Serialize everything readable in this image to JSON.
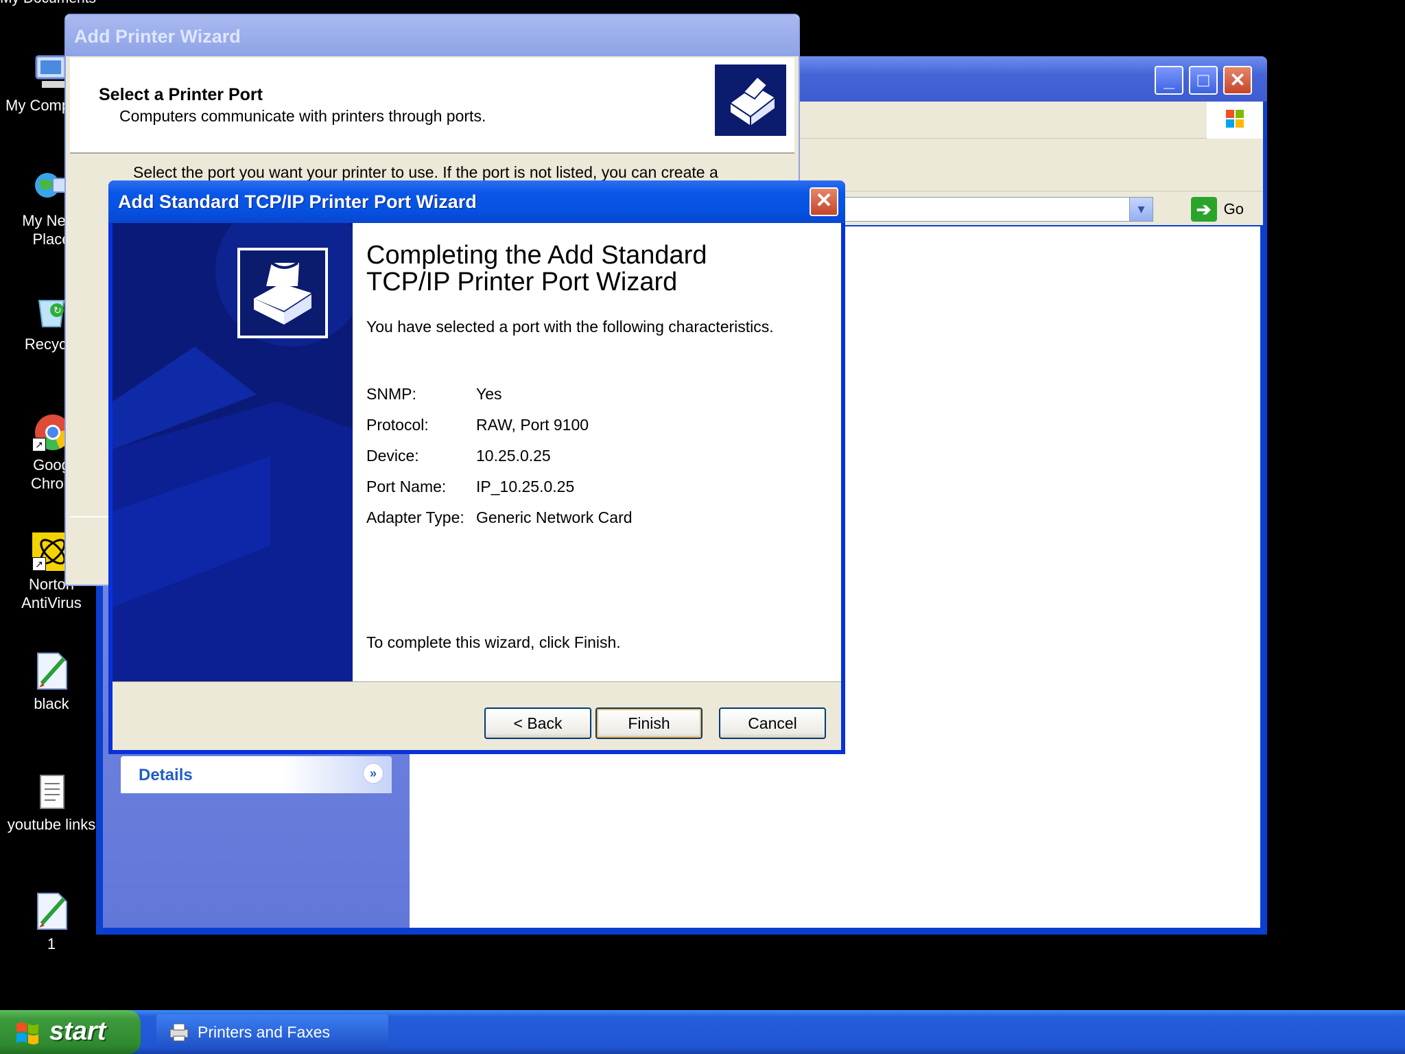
{
  "desktop": {
    "top_text": "My Documents",
    "icons": [
      {
        "label": "My Comp",
        "icon": "my-computer-icon"
      },
      {
        "label": "My Netw\nPlace",
        "icon": "my-network-places-icon"
      },
      {
        "label": "Recycle",
        "icon": "recycle-bin-icon"
      },
      {
        "label": "Goog\nChron",
        "icon": "google-chrome-icon"
      },
      {
        "label": "Norton\nAntiVirus",
        "icon": "norton-antivirus-icon"
      },
      {
        "label": "black",
        "icon": "image-file-icon"
      },
      {
        "label": "youtube links",
        "icon": "text-file-icon"
      },
      {
        "label": "1",
        "icon": "image-file-icon"
      }
    ]
  },
  "printers_window": {
    "address_go_label": "Go",
    "details_label": "Details",
    "controls": [
      "minimize",
      "maximize",
      "close"
    ]
  },
  "add_printer_wizard": {
    "title": "Add Printer Wizard",
    "heading": "Select a Printer Port",
    "subheading": "Computers communicate with printers through ports.",
    "body": "Select the port you want your printer to use.  If the port is not listed, you can create a"
  },
  "tcp_wizard": {
    "title": "Add Standard TCP/IP Printer Port Wizard",
    "heading_line1": "Completing the Add Standard",
    "heading_line2": "TCP/IP Printer Port Wizard",
    "intro": "You have selected a port with the following characteristics.",
    "properties": [
      {
        "key": "SNMP:",
        "value": "Yes"
      },
      {
        "key": "Protocol:",
        "value": "RAW, Port 9100"
      },
      {
        "key": "Device:",
        "value": "10.25.0.25"
      },
      {
        "key": "Port Name:",
        "value": "IP_10.25.0.25"
      },
      {
        "key": "Adapter Type:",
        "value": "Generic Network Card"
      }
    ],
    "finish_note": "To complete this wizard, click Finish.",
    "buttons": {
      "back": "< Back",
      "finish": "Finish",
      "cancel": "Cancel"
    }
  },
  "taskbar": {
    "start_label": "start",
    "items": [
      {
        "label": "Printers and Faxes",
        "icon": "printer-icon"
      }
    ]
  },
  "colors": {
    "xp_blue": "#0a56e7",
    "taskbar_blue": "#245edb",
    "start_green": "#3c9a3c",
    "dialog_bg": "#ece9d8"
  }
}
